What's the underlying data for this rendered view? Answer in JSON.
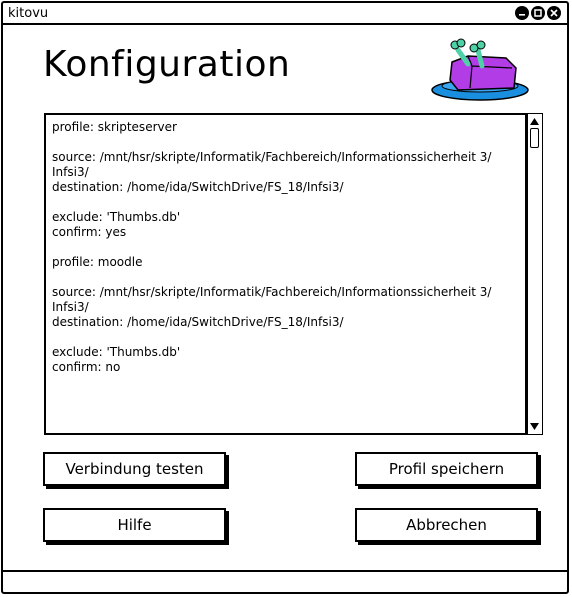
{
  "window": {
    "title": "kitovu"
  },
  "header": {
    "title": "Konfiguration"
  },
  "config": {
    "text": "profile: skripteserver\n\nsource: /mnt/hsr/skripte/Informatik/Fachbereich/Informationssicherheit 3/\nInfsi3/\ndestination: /home/ida/SwitchDrive/FS_18/Infsi3/\n\nexclude: 'Thumbs.db'\nconfirm: yes\n\nprofile: moodle\n\nsource: /mnt/hsr/skripte/Informatik/Fachbereich/Informationssicherheit 3/\nInfsi3/\ndestination: /home/ida/SwitchDrive/FS_18/Infsi3/\n\nexclude: 'Thumbs.db'\nconfirm: no"
  },
  "buttons": {
    "test_connection": "Verbindung testen",
    "save_profile": "Profil speichern",
    "help": "Hilfe",
    "cancel": "Abbrechen"
  },
  "colors": {
    "logo_plate": "#1a8fe0",
    "logo_meat": "#b23ce6",
    "logo_bone": "#4fd1a8"
  }
}
